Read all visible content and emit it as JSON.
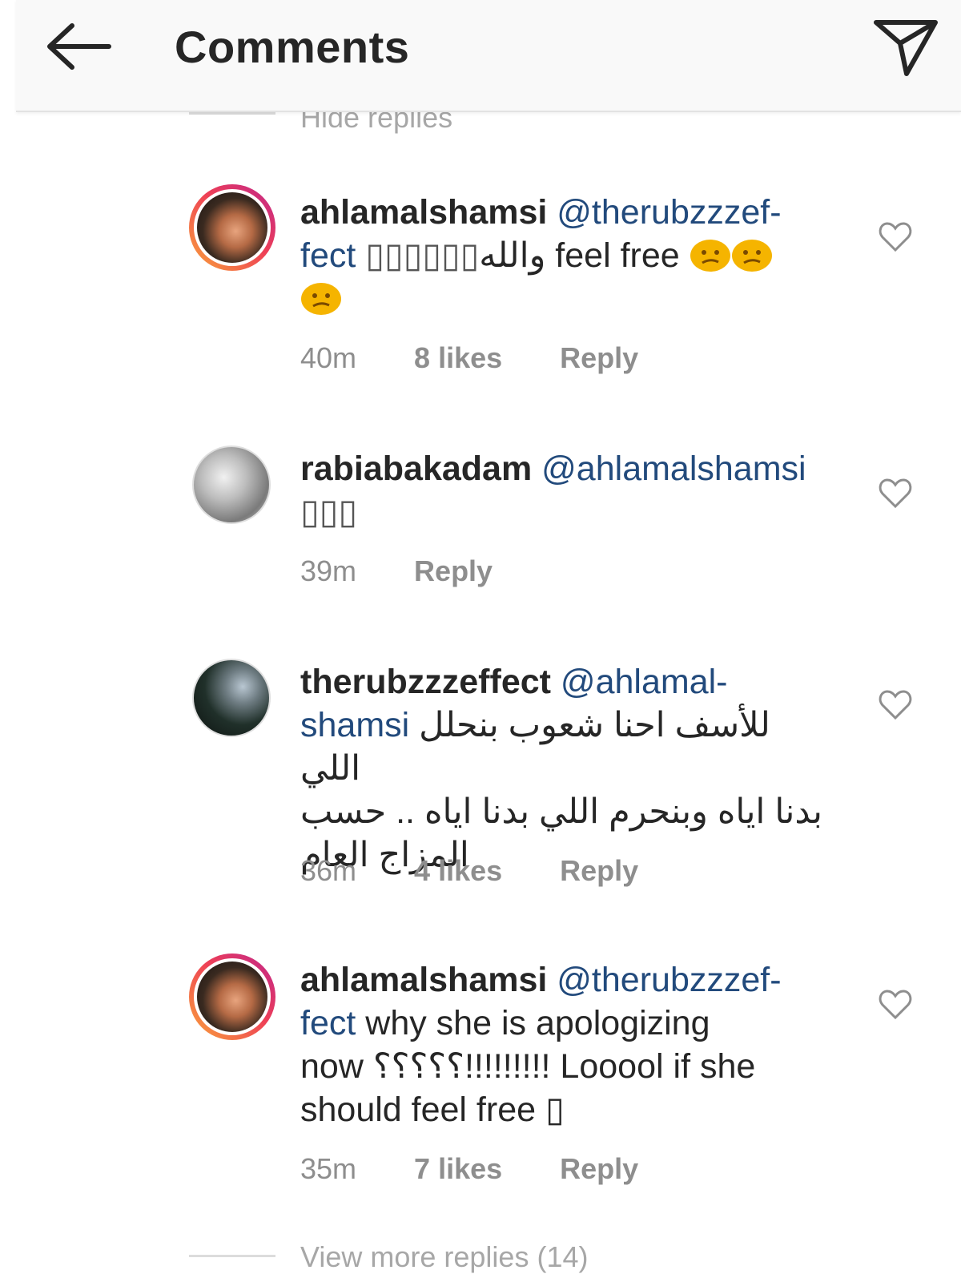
{
  "header": {
    "title": "Comments"
  },
  "hide_replies": "Hide replies",
  "comments": [
    {
      "username": "ahlamalshamsi",
      "mention": "@therubzzzef-",
      "mention_cont": "fect",
      "body_boxes": "▯▯▯▯▯▯",
      "body_arabic": "والله",
      "body_text": " feel free",
      "emoji": [
        "confused-face",
        "confused-face",
        "confused-face"
      ],
      "time": "40m",
      "likes": "8 likes",
      "reply": "Reply"
    },
    {
      "username": "rabiabakadam",
      "mention": "@ahlamalshamsi",
      "body_text": "▯▯▯",
      "time": "39m",
      "reply": "Reply"
    },
    {
      "username": "therubzzzeffect",
      "mention": "@ahlamal-",
      "mention_cont": "shamsi",
      "body_arabic_1": "للأسف احنا شعوب بنحلل اللي",
      "body_arabic_2": "بدنا اياه وبنحرم اللي بدنا اياه .. حسب",
      "body_arabic_3": "المزاج العام",
      "time": "36m",
      "likes": "4 likes",
      "reply": "Reply"
    },
    {
      "username": "ahlamalshamsi",
      "mention": "@therubzzzef-",
      "mention_cont": "fect",
      "body_line_1": " why she is apologizing",
      "body_line_2": "now ؟؟؟؟؟!!!!!!!!! Looool if she",
      "body_line_3": "should feel free ▯",
      "time": "35m",
      "likes": "7 likes",
      "reply": "Reply"
    }
  ],
  "view_more": "View more replies (14)",
  "colors": {
    "mention": "#224a7c",
    "meta": "#8e8e8e",
    "emoji": "#f5b400"
  }
}
